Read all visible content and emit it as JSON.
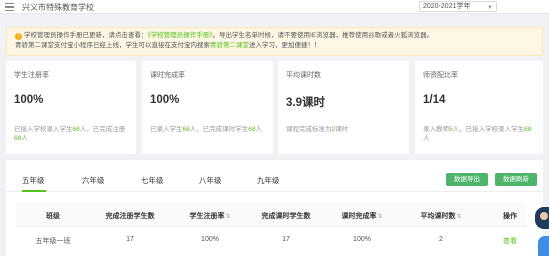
{
  "header": {
    "school_name": "兴义市特殊教育学校",
    "year": "2020-2021学年"
  },
  "notice": {
    "line1_prefix": "学校管理员操作手册已更新，请点击查看：",
    "line1_link": "《学校管理员操作手册》",
    "line1_suffix": "。导出学生名单时候，请不要使用IE浏览器，推荐使用谷歌或者火狐浏览器。",
    "line2_prefix": "青骄第二课堂支付宝小程序已经上线，学生可以直接在支付宝内搜索",
    "line2_link": "青骄第二课堂",
    "line2_suffix": "进入学习，更加便捷！！"
  },
  "cards": [
    {
      "title": "学生注册率",
      "value": "100%",
      "desc_a": "已接入学校录入学生",
      "desc_hl": "68",
      "desc_b": "人，已完成注册",
      "desc_hl2": "68",
      "desc_c": "人"
    },
    {
      "title": "课时完成率",
      "value": "100%",
      "desc_a": "已录入学生",
      "desc_hl": "68",
      "desc_b": "人，已完成课时学生",
      "desc_hl2": "68",
      "desc_c": "人"
    },
    {
      "title": "平均课时数",
      "value": "3.9课时",
      "desc_a": "课程完成标准为",
      "desc_hl": "2",
      "desc_b": "课时",
      "desc_hl2": "",
      "desc_c": ""
    },
    {
      "title": "师资配比率",
      "value": "1/14",
      "desc_a": "录入教师",
      "desc_hl": "5",
      "desc_b": "人，已接入学校录入学生",
      "desc_hl2": "68",
      "desc_c": "人"
    }
  ],
  "tabs": [
    "五年级",
    "六年级",
    "七年级",
    "八年级",
    "九年级"
  ],
  "buttons": {
    "export": "数据导出",
    "refresh": "数据刷新"
  },
  "table": {
    "headers": [
      "班级",
      "完成注册学生数",
      "学生注册率",
      "完成课时学生数",
      "课时完成率",
      "平均课时数",
      "操作"
    ],
    "rows": [
      [
        "五年级一班",
        "17",
        "100%",
        "17",
        "100%",
        "2",
        "查看"
      ]
    ]
  },
  "colors": {
    "accent": "#52c41a",
    "button": "#4cb56a",
    "warning": "#faad14"
  }
}
